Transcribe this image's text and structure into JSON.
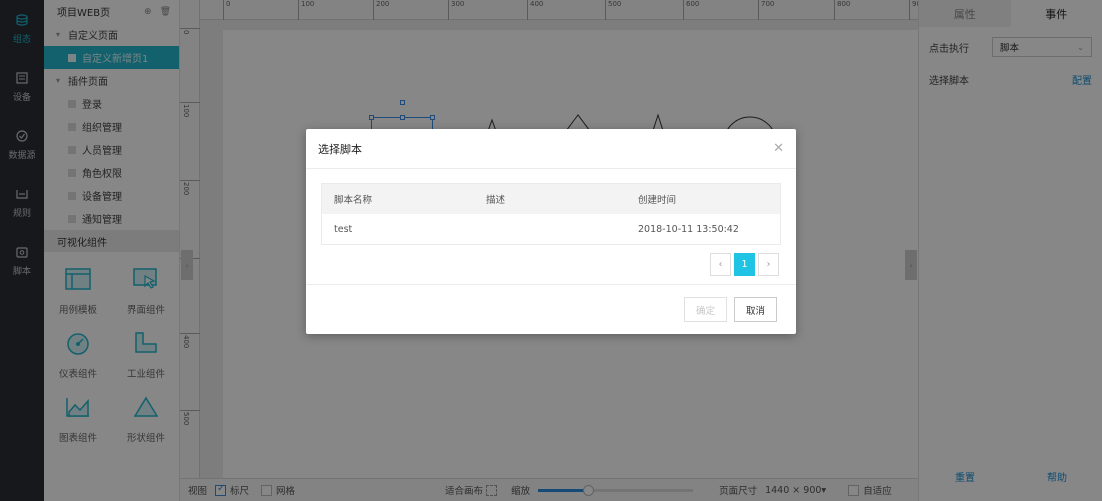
{
  "nav": [
    {
      "id": "config",
      "label": "组态",
      "active": true,
      "icon": "layers-icon"
    },
    {
      "id": "device",
      "label": "设备",
      "active": false,
      "icon": "device-icon"
    },
    {
      "id": "datasource",
      "label": "数据源",
      "active": false,
      "icon": "database-icon"
    },
    {
      "id": "rule",
      "label": "规则",
      "active": false,
      "icon": "rule-icon"
    },
    {
      "id": "script",
      "label": "脚本",
      "active": false,
      "icon": "script-icon"
    }
  ],
  "tree": {
    "header": "项目WEB页",
    "groups": [
      {
        "label": "自定义页面",
        "items": [
          "自定义新增页1"
        ]
      },
      {
        "label": "插件页面",
        "items": [
          "登录",
          "组织管理",
          "人员管理",
          "角色权限",
          "设备管理",
          "通知管理"
        ]
      }
    ]
  },
  "components": {
    "title": "可视化组件",
    "items": [
      "用例模板",
      "界面组件",
      "仪表组件",
      "工业组件",
      "图表组件",
      "形状组件"
    ]
  },
  "ruler": {
    "h_ticks": [
      "0",
      "100",
      "200",
      "300",
      "400",
      "500",
      "600",
      "700",
      "800",
      "90"
    ],
    "v_ticks": [
      "0",
      "100",
      "200",
      "300",
      "400",
      "500"
    ]
  },
  "bottom_bar": {
    "view_label": "视图",
    "ruler_label": "标尺",
    "ruler_checked": true,
    "grid_label": "网格",
    "grid_checked": false,
    "fit_label": "适合画布",
    "zoom_label": "缩放",
    "zoom_value": 0.32,
    "page_size_label": "页面尺寸",
    "page_size_value": "1440 × 900",
    "adaptive_label": "自适应",
    "adaptive_checked": false
  },
  "right_panel": {
    "tabs": [
      "属性",
      "事件"
    ],
    "active_tab": 1,
    "trigger_label": "点击执行",
    "trigger_value": "脚本",
    "script_label": "选择脚本",
    "config_link": "配置",
    "reset_label": "重置",
    "help_label": "帮助"
  },
  "modal": {
    "title": "选择脚本",
    "columns": [
      "脚本名称",
      "描述",
      "创建时间"
    ],
    "rows": [
      {
        "name": "test",
        "description": "",
        "created": "2018-10-11 13:50:42"
      }
    ],
    "current_page": "1",
    "ok_label": "确定",
    "cancel_label": "取消"
  },
  "colors": {
    "accent": "#22b7cc",
    "link": "#1890d5",
    "sidebar_dark": "#2b2f36",
    "page_active": "#1fc3e4"
  }
}
